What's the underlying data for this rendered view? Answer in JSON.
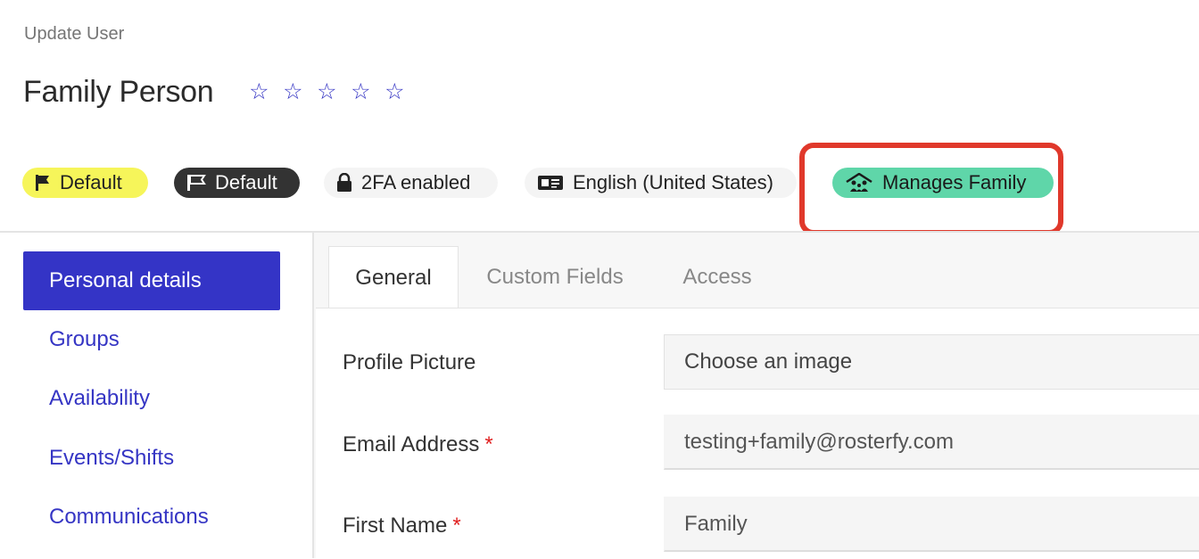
{
  "breadcrumb": "Update User",
  "title": "Family Person",
  "rating": {
    "value": 0,
    "max": 5,
    "star_glyph": "☆"
  },
  "badges": {
    "priority_light": "Default",
    "priority_dark": "Default",
    "twofa": "2FA enabled",
    "language": "English (United States)",
    "family": "Manages Family"
  },
  "sidebar": {
    "items": [
      {
        "label": "Personal details",
        "active": true
      },
      {
        "label": "Groups"
      },
      {
        "label": "Availability"
      },
      {
        "label": "Events/Shifts"
      },
      {
        "label": "Communications"
      }
    ]
  },
  "tabs": [
    {
      "label": "General",
      "active": true
    },
    {
      "label": "Custom Fields"
    },
    {
      "label": "Access"
    }
  ],
  "form": {
    "profile_picture": {
      "label": "Profile Picture",
      "placeholder": "Choose an image"
    },
    "email": {
      "label": "Email Address",
      "required": "*",
      "value": "testing+family@rosterfy.com"
    },
    "first_name": {
      "label": "First Name",
      "required": "*",
      "value": "Family"
    }
  },
  "colors": {
    "accent": "#3434c6",
    "highlight": "#e0382b",
    "family_badge": "#5fd6a9",
    "yellow_badge": "#f6f55a"
  }
}
